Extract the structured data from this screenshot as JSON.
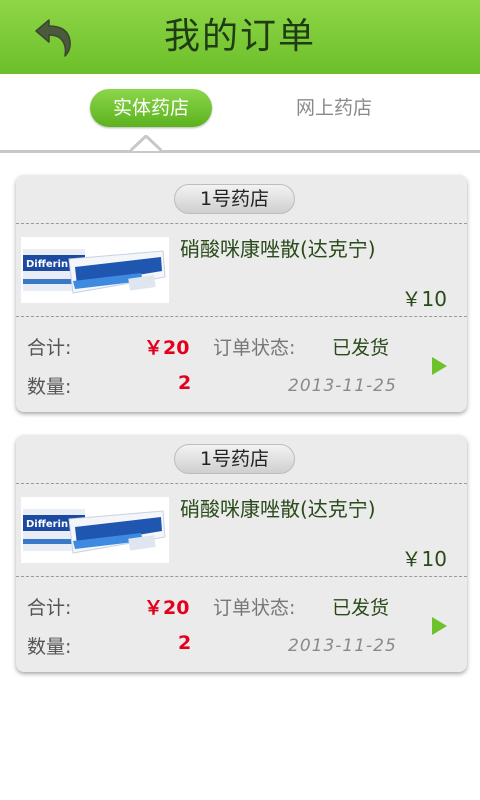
{
  "header": {
    "title": "我的订单",
    "back_icon": "back-arrow-icon"
  },
  "tabs": [
    {
      "label": "实体药店",
      "active": true
    },
    {
      "label": "网上药店",
      "active": false
    }
  ],
  "orders": [
    {
      "shop": "1号药店",
      "product": {
        "name": "硝酸咪康唑散(达克宁)",
        "price": "￥10",
        "image_brand": "Differin"
      },
      "total_label": "合计:",
      "total_value": "￥20",
      "qty_label": "数量:",
      "qty_value": "2",
      "status_label": "订单状态:",
      "status_value": "已发货",
      "date": "2013-11-25"
    },
    {
      "shop": "1号药店",
      "product": {
        "name": "硝酸咪康唑散(达克宁)",
        "price": "￥10",
        "image_brand": "Differin"
      },
      "total_label": "合计:",
      "total_value": "￥20",
      "qty_label": "数量:",
      "qty_value": "2",
      "status_label": "订单状态:",
      "status_value": "已发货",
      "date": "2013-11-25"
    }
  ],
  "colors": {
    "accent": "#6cbf2a",
    "price_red": "#e4001c"
  }
}
